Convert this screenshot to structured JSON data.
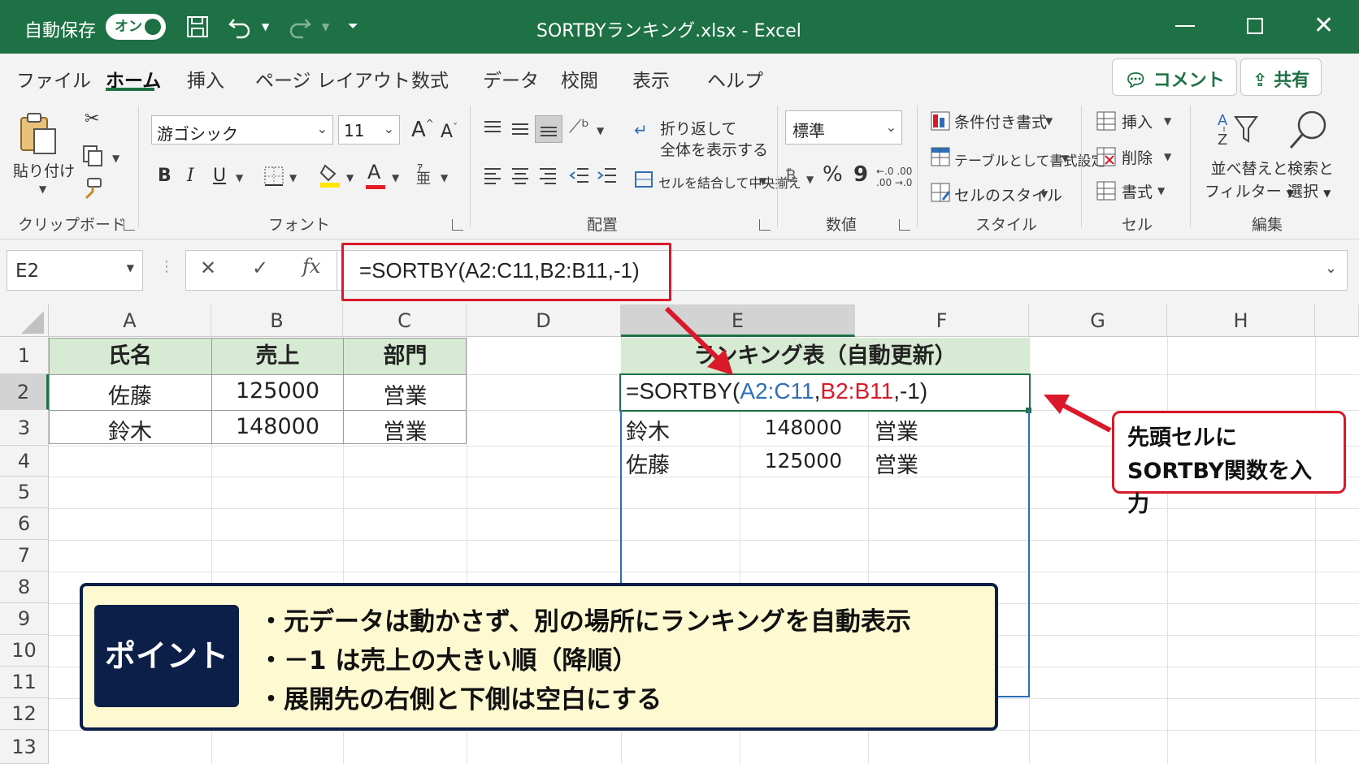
{
  "titlebar": {
    "autosave_label": "自動保存",
    "autosave_state": "オン",
    "file_title": "SORTBYランキング.xlsx  -  Excel"
  },
  "menu": {
    "tabs": [
      "ファイル",
      "ホーム",
      "挿入",
      "ページ レイアウト",
      "数式",
      "データ",
      "校閲",
      "表示",
      "ヘルプ"
    ],
    "active_tab": "ホーム",
    "comment_button": "コメント",
    "share_button": "共有"
  },
  "ribbon": {
    "clipboard": {
      "paste_label": "貼り付け",
      "group_label": "クリップボード"
    },
    "font": {
      "font_name": "游ゴシック",
      "font_size": "11",
      "bold": "B",
      "italic": "I",
      "underline": "U",
      "font_color_glyph": "A",
      "grow_glyph": "A",
      "shrink_glyph": "A",
      "group_label": "フォント"
    },
    "alignment": {
      "wrap_text": "折り返して\n全体を表示する",
      "wrap_line1": "折り返して",
      "wrap_line2": "全体を表示する",
      "merge_center": "セルを結合して中央揃え",
      "group_label": "配置"
    },
    "number": {
      "format": "標準",
      "percent": "%",
      "comma": "9",
      "group_label": "数値"
    },
    "styles": {
      "conditional": "条件付き書式",
      "as_table": "テーブルとして書式設定",
      "cell_styles": "セルのスタイル",
      "group_label": "スタイル"
    },
    "cells": {
      "insert": "挿入",
      "delete": "削除",
      "format": "書式",
      "group_label": "セル"
    },
    "editing": {
      "sort_filter_1": "並べ替えと",
      "sort_filter_2": "フィルター",
      "find_select_1": "検索と",
      "find_select_2": "選択",
      "group_label": "編集"
    }
  },
  "formula_bar": {
    "name_box": "E2",
    "cancel": "✕",
    "enter": "✓",
    "fx": "fx",
    "formula": "=SORTBY(A2:C11,B2:B11,-1)"
  },
  "sheet": {
    "columns": [
      "A",
      "B",
      "C",
      "D",
      "E",
      "F",
      "G",
      "H"
    ],
    "rows": [
      "1",
      "2",
      "3",
      "4",
      "5",
      "6",
      "7",
      "8",
      "9",
      "10",
      "11",
      "12",
      "13"
    ],
    "source_headers": [
      "氏名",
      "売上",
      "部門"
    ],
    "source_rows": [
      [
        "佐藤",
        "125000",
        "営業"
      ],
      [
        "鈴木",
        "148000",
        "営業"
      ]
    ],
    "ranking_header": "ランキング表（自動更新）",
    "formula_parts": {
      "prefix": "=SORTBY(",
      "ref1": "A2:C11",
      "sep1": ",",
      "ref2": "B2:B11",
      "suffix": ",-1)"
    },
    "ranking_rows": [
      [
        "鈴木",
        "148000",
        "営業"
      ],
      [
        "佐藤",
        "125000",
        "営業"
      ]
    ],
    "colors": {
      "ref1": "#2e6fb7",
      "ref2": "#d9192a",
      "header_fill": "#d7ead3",
      "excel_green": "#1e7145"
    }
  },
  "callout": {
    "line1": "先頭セルに",
    "line2": "SORTBY関数を入力"
  },
  "point": {
    "label": "ポイント",
    "bullets": [
      "・元データは動かさず、別の場所にランキングを自動表示",
      "・－1 は売上の大きい順（降順）",
      "・展開先の右側と下側は空白にする"
    ]
  }
}
